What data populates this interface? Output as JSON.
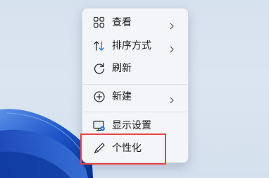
{
  "desktop": {
    "wallpaper": "windows-11-bloom-blue"
  },
  "context_menu": {
    "items": [
      {
        "label": "查看",
        "icon": "grid-view-icon",
        "has_submenu": true
      },
      {
        "label": "排序方式",
        "icon": "sort-arrows-icon",
        "has_submenu": true
      },
      {
        "label": "刷新",
        "icon": "refresh-icon",
        "has_submenu": false
      },
      {
        "label": "新建",
        "icon": "plus-circle-icon",
        "has_submenu": true
      },
      {
        "label": "显示设置",
        "icon": "display-settings-icon",
        "has_submenu": false
      },
      {
        "label": "个性化",
        "icon": "pen-brush-icon",
        "has_submenu": false
      }
    ]
  },
  "annotation": {
    "highlight_color": "#e84444",
    "highlighted_item": "个性化"
  },
  "colors": {
    "menu_bg": "#f3f5f8",
    "text": "#1a1a1a",
    "icon": "#2b2b2b",
    "accent_blue": "#1e6fd6"
  }
}
